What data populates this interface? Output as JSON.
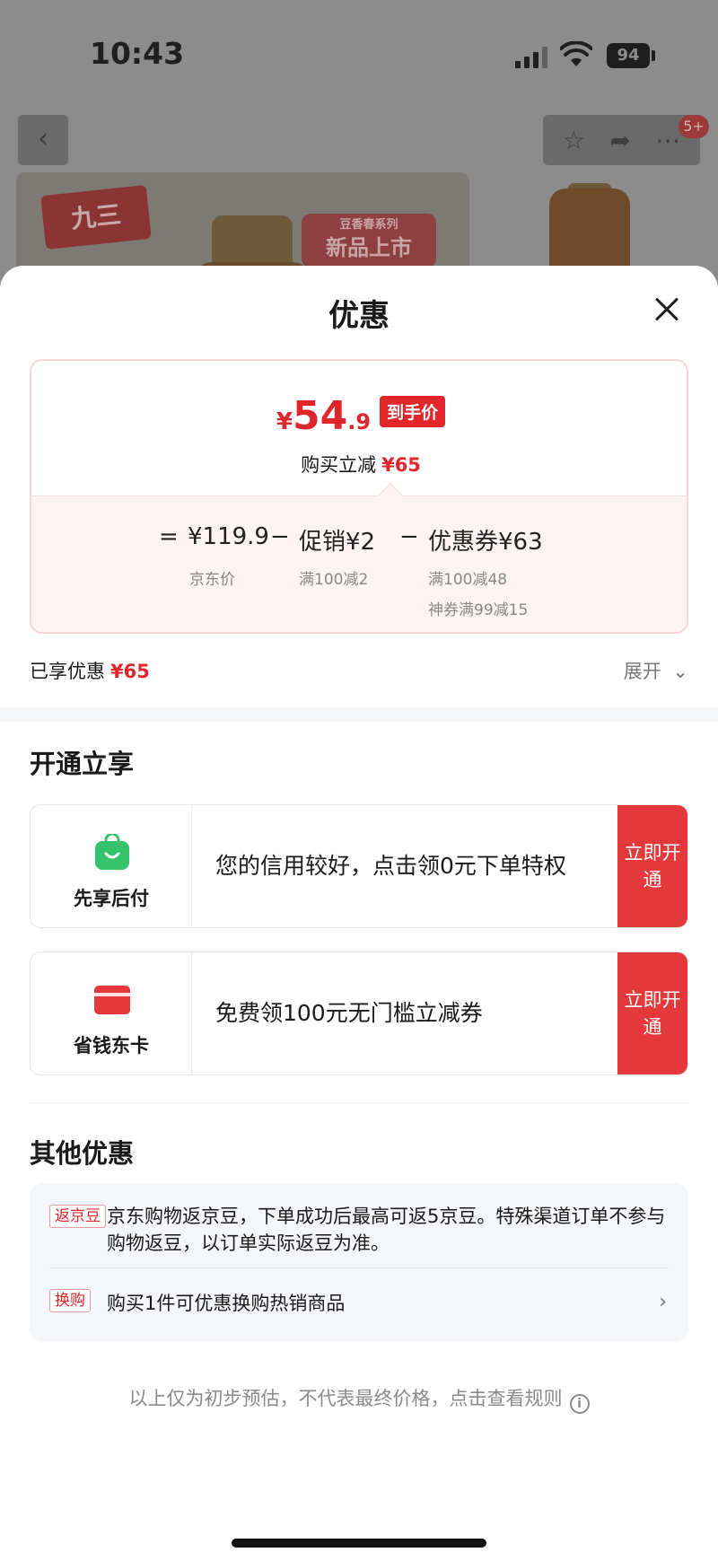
{
  "status_bar": {
    "time": "10:43",
    "battery": "94"
  },
  "background": {
    "cart_badge": "5+",
    "brand_logo": "九三",
    "banner_small": "豆香春系列",
    "banner_big": "新品上市"
  },
  "sheet": {
    "title": "优惠"
  },
  "price_card": {
    "yen": "¥",
    "price_int": "54",
    "price_dec": ".9",
    "price_tag": "到手价",
    "instant_off_label": "购买立减",
    "instant_off_amount": "¥65",
    "breakdown": {
      "equals": "=",
      "jd_price": "¥119.9",
      "jd_price_label": "京东价",
      "minus1": "−",
      "promo": "促销¥2",
      "promo_rule": "满100减2",
      "minus2": "−",
      "coupon": "优惠券¥63",
      "coupon_rule1": "满100减48",
      "coupon_rule2": "神券满99减15"
    }
  },
  "applied": {
    "label": "已享优惠",
    "amount": "¥65",
    "expand": "展开"
  },
  "open_section": {
    "title": "开通立享",
    "cards": [
      {
        "name": "先享后付",
        "text": "您的信用较好，点击领0元下单特权",
        "button": "立即开通",
        "icon": "shopping-bag-icon",
        "color": "#34c26b"
      },
      {
        "name": "省钱东卡",
        "text": "免费领100元无门槛立减券",
        "button": "立即开通",
        "icon": "card-icon",
        "color": "#e5383b"
      }
    ]
  },
  "other_section": {
    "title": "其他优惠",
    "jd_bean_tag": "返京豆",
    "jd_bean_text": "京东购物返京豆，下单成功后最高可返5京豆。特殊渠道订单不参与购物返豆，以订单实际返豆为准。",
    "swap_tag": "换购",
    "swap_text": "购买1件可优惠换购热销商品"
  },
  "footnote": "以上仅为初步预估，不代表最终价格，点击查看规则",
  "colors": {
    "accent": "#e0262b",
    "button": "#e5383b",
    "green": "#34c26b"
  }
}
